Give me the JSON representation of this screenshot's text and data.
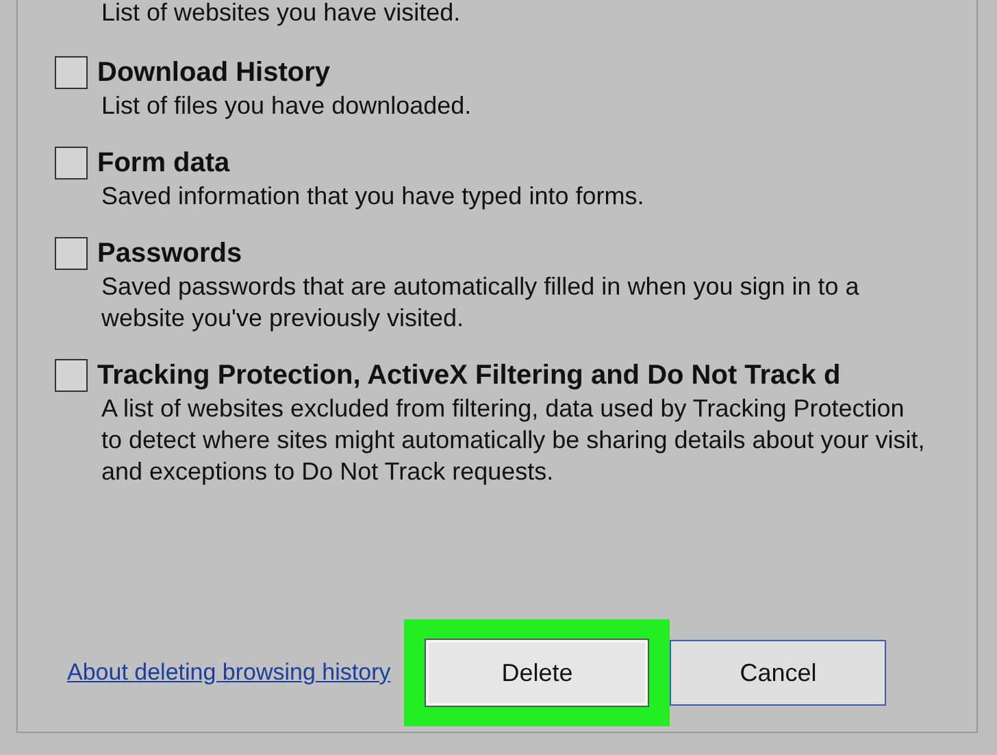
{
  "options": [
    {
      "description": "List of websites you have visited."
    },
    {
      "title": "Download History",
      "description": "List of files you have downloaded.",
      "checked": false
    },
    {
      "title": "Form data",
      "description": "Saved information that you have typed into forms.",
      "checked": false
    },
    {
      "title": "Passwords",
      "description": "Saved passwords that are automatically filled in when you sign in to a website you've previously visited.",
      "checked": false
    },
    {
      "title": "Tracking Protection, ActiveX Filtering and Do Not Track d",
      "description": "A list of websites excluded from filtering, data used by Tracking Protection to detect where sites might automatically be sharing details about your visit, and exceptions to Do Not Track requests.",
      "checked": false
    }
  ],
  "footer": {
    "link": "About deleting browsing history",
    "buttons": [
      {
        "label": "Delete",
        "highlighted": true
      },
      {
        "label": "Cancel",
        "highlighted": false
      }
    ]
  }
}
